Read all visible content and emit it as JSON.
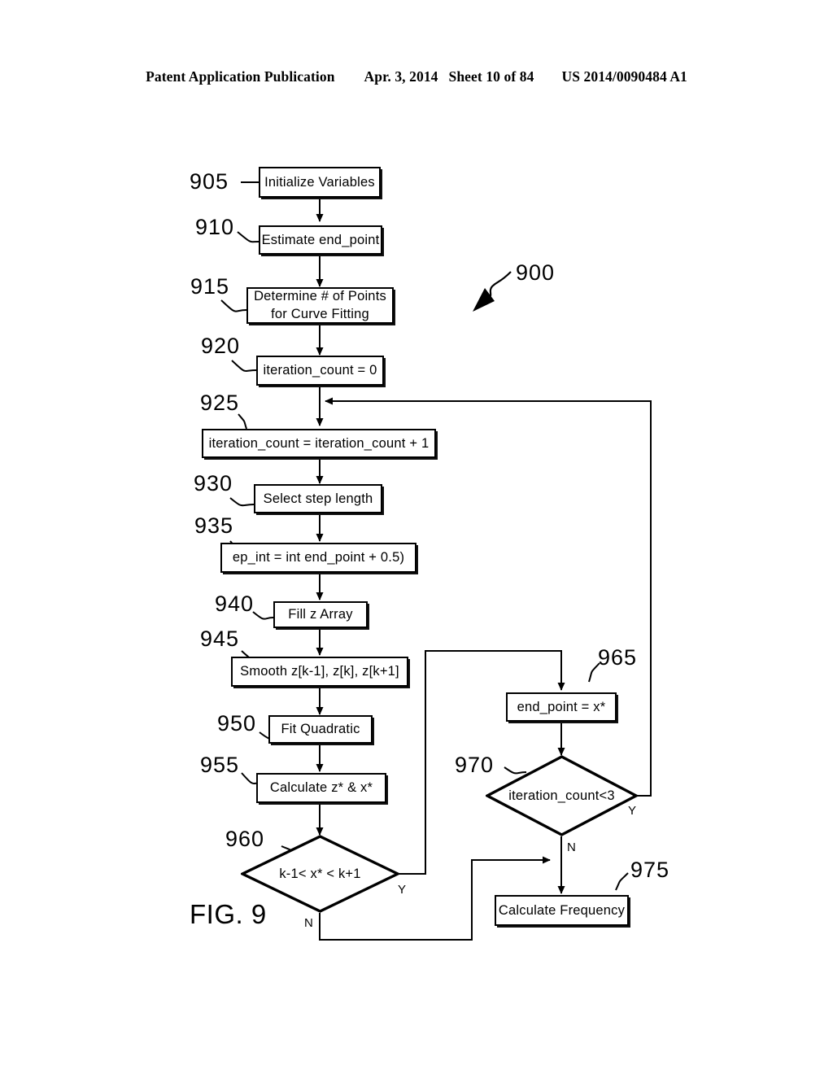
{
  "header": {
    "title": "Patent Application Publication",
    "date": "Apr. 3, 2014",
    "sheet": "Sheet 10 of 84",
    "publication_number": "US 2014/0090484 A1"
  },
  "figure": {
    "caption": "FIG. 9",
    "diagram_ref": "900",
    "type": "flowchart",
    "nodes": [
      {
        "ref": "905",
        "shape": "process",
        "label": "Initialize Variables"
      },
      {
        "ref": "910",
        "shape": "process",
        "label": "Estimate end_point"
      },
      {
        "ref": "915",
        "shape": "process",
        "label_line1": "Determine # of Points",
        "label_line2": "for Curve Fitting"
      },
      {
        "ref": "920",
        "shape": "process",
        "label": "iteration_count = 0"
      },
      {
        "ref": "925",
        "shape": "process",
        "label": "iteration_count = iteration_count + 1"
      },
      {
        "ref": "930",
        "shape": "process",
        "label": "Select step length"
      },
      {
        "ref": "935",
        "shape": "process",
        "label": "ep_int = int end_point + 0.5)"
      },
      {
        "ref": "940",
        "shape": "process",
        "label": "Fill z Array"
      },
      {
        "ref": "945",
        "shape": "process",
        "label": "Smooth z[k-1], z[k], z[k+1]"
      },
      {
        "ref": "950",
        "shape": "process",
        "label": "Fit Quadratic"
      },
      {
        "ref": "955",
        "shape": "process",
        "label": "Calculate z* & x*"
      },
      {
        "ref": "960",
        "shape": "decision",
        "label": "k-1< x* < k+1",
        "yes": "Y",
        "no": "N"
      },
      {
        "ref": "965",
        "shape": "process",
        "label": "end_point = x*"
      },
      {
        "ref": "970",
        "shape": "decision",
        "label": "iteration_count<3",
        "yes": "Y",
        "no": "N"
      },
      {
        "ref": "975",
        "shape": "process",
        "label": "Calculate Frequency"
      }
    ]
  }
}
